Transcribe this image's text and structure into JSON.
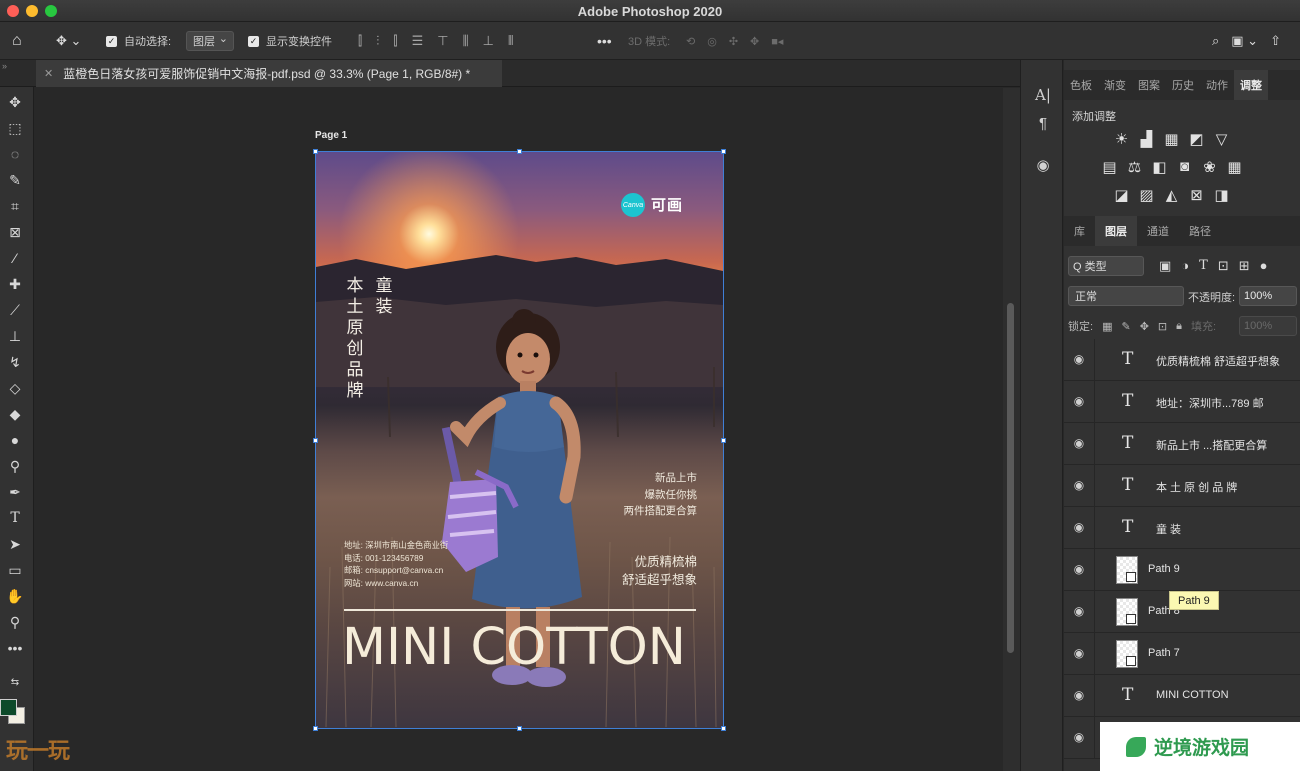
{
  "window": {
    "title": "Adobe Photoshop 2020"
  },
  "options_bar": {
    "auto_select_label": "自动选择:",
    "auto_select_value": "图层",
    "show_transform_label": "显示变换控件",
    "mode_3d_label": "3D 模式:"
  },
  "document": {
    "tab_title": "蓝橙色日落女孩可爱服饰促销中文海报-pdf.psd @ 33.3% (Page 1, RGB/8#) *",
    "page_label": "Page 1"
  },
  "poster": {
    "logo_badge": "Canva",
    "logo_text": "可画",
    "vertical_col1": "本土原创品牌",
    "vertical_col2": "童装",
    "promo_lines": [
      "新品上市",
      "爆款任你挑",
      "两件搭配更合算"
    ],
    "quality_lines": [
      "优质精梳棉",
      "舒适超乎想象"
    ],
    "contact_lines": [
      "地址: 深圳市南山金色商业街",
      "电话: 001-123456789",
      "邮箱: cnsupport@canva.cn",
      "网站: www.canva.cn"
    ],
    "headline": "MINI COTTON"
  },
  "panels": {
    "top_tabs": [
      "色板",
      "渐变",
      "图案",
      "历史",
      "动作",
      "调整"
    ],
    "active_top_tab": "调整",
    "adjustments_title": "添加调整",
    "layer_tabs": [
      "库",
      "图层",
      "通道",
      "路径"
    ],
    "active_layer_tab": "图层",
    "filter_label": "Q 类型",
    "blend_mode": "正常",
    "opacity_label": "不透明度:",
    "opacity_value": "100%",
    "lock_label": "锁定:",
    "fill_label": "填充:",
    "fill_value": "100%",
    "layers": [
      {
        "name": "优质精梳棉 舒适超乎想象",
        "kind": "text"
      },
      {
        "name": "地址：深圳市...789 邮",
        "kind": "text"
      },
      {
        "name": "新品上市 ...搭配更合算",
        "kind": "text"
      },
      {
        "name": "本 土 原 创 品 牌",
        "kind": "text"
      },
      {
        "name": "童 装",
        "kind": "text"
      },
      {
        "name": "Path 9",
        "kind": "path"
      },
      {
        "name": "Path 8",
        "kind": "path"
      },
      {
        "name": "Path 7",
        "kind": "path"
      },
      {
        "name": "MINI COTTON",
        "kind": "text"
      },
      {
        "name": "",
        "kind": "text"
      }
    ],
    "tooltip": "Path 9"
  },
  "watermarks": {
    "right": "逆境游戏园",
    "left": "玩一玩"
  },
  "colors": {
    "selection": "#3f7fd6",
    "foreground": "#0d4a2a",
    "background": "#f3efe3",
    "logo": "#1cc4d0"
  }
}
